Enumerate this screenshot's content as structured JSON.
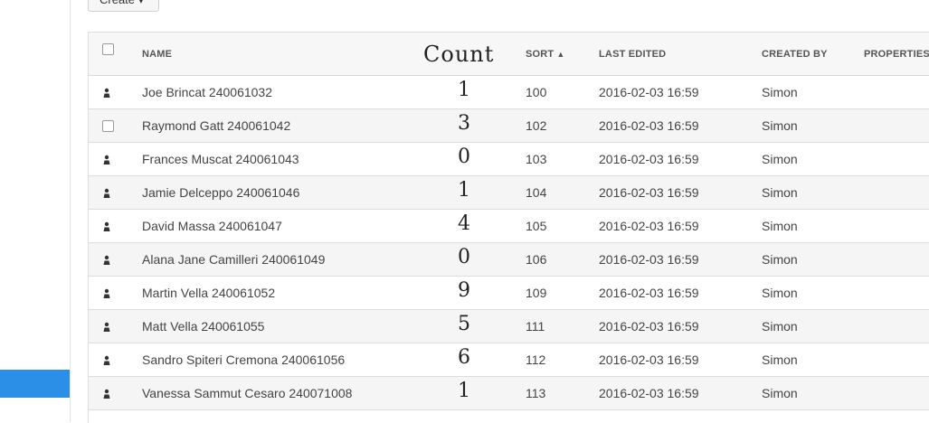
{
  "toolbar": {
    "create_label": "Create ▾"
  },
  "table": {
    "headers": {
      "name": "NAME",
      "count": "Count",
      "sort": "SORT",
      "sort_caret": "▲",
      "last_edited": "LAST EDITED",
      "created_by": "CREATED BY",
      "properties": "PROPERTIES"
    },
    "rows": [
      {
        "name": "Joe Brincat 240061032",
        "count": "1",
        "sort": "100",
        "last_edited": "2016-02-03 16:59",
        "created_by": "Simon",
        "icon": "user-icon"
      },
      {
        "name": "Raymond Gatt 240061042",
        "count": "3",
        "sort": "102",
        "last_edited": "2016-02-03 16:59",
        "created_by": "Simon",
        "icon": "checkbox"
      },
      {
        "name": "Frances Muscat 240061043",
        "count": "0",
        "sort": "103",
        "last_edited": "2016-02-03 16:59",
        "created_by": "Simon",
        "icon": "user-icon"
      },
      {
        "name": "Jamie Delceppo 240061046",
        "count": "1",
        "sort": "104",
        "last_edited": "2016-02-03 16:59",
        "created_by": "Simon",
        "icon": "user-icon"
      },
      {
        "name": "David Massa 240061047",
        "count": "4",
        "sort": "105",
        "last_edited": "2016-02-03 16:59",
        "created_by": "Simon",
        "icon": "user-icon"
      },
      {
        "name": "Alana Jane Camilleri 240061049",
        "count": "0",
        "sort": "106",
        "last_edited": "2016-02-03 16:59",
        "created_by": "Simon",
        "icon": "user-icon"
      },
      {
        "name": "Martin Vella 240061052",
        "count": "9",
        "sort": "109",
        "last_edited": "2016-02-03 16:59",
        "created_by": "Simon",
        "icon": "user-icon"
      },
      {
        "name": "Matt Vella 240061055",
        "count": "5",
        "sort": "111",
        "last_edited": "2016-02-03 16:59",
        "created_by": "Simon",
        "icon": "user-icon"
      },
      {
        "name": "Sandro Spiteri Cremona 240061056",
        "count": "6",
        "sort": "112",
        "last_edited": "2016-02-03 16:59",
        "created_by": "Simon",
        "icon": "user-icon"
      },
      {
        "name": "Vanessa Sammut Cesaro 240071008",
        "count": "1",
        "sort": "113",
        "last_edited": "2016-02-03 16:59",
        "created_by": "Simon",
        "icon": "user-icon"
      }
    ]
  },
  "colors": {
    "accent": "#2b8fe8",
    "header_bg": "#f7f7f7",
    "stripe": "#f5f5f5"
  }
}
